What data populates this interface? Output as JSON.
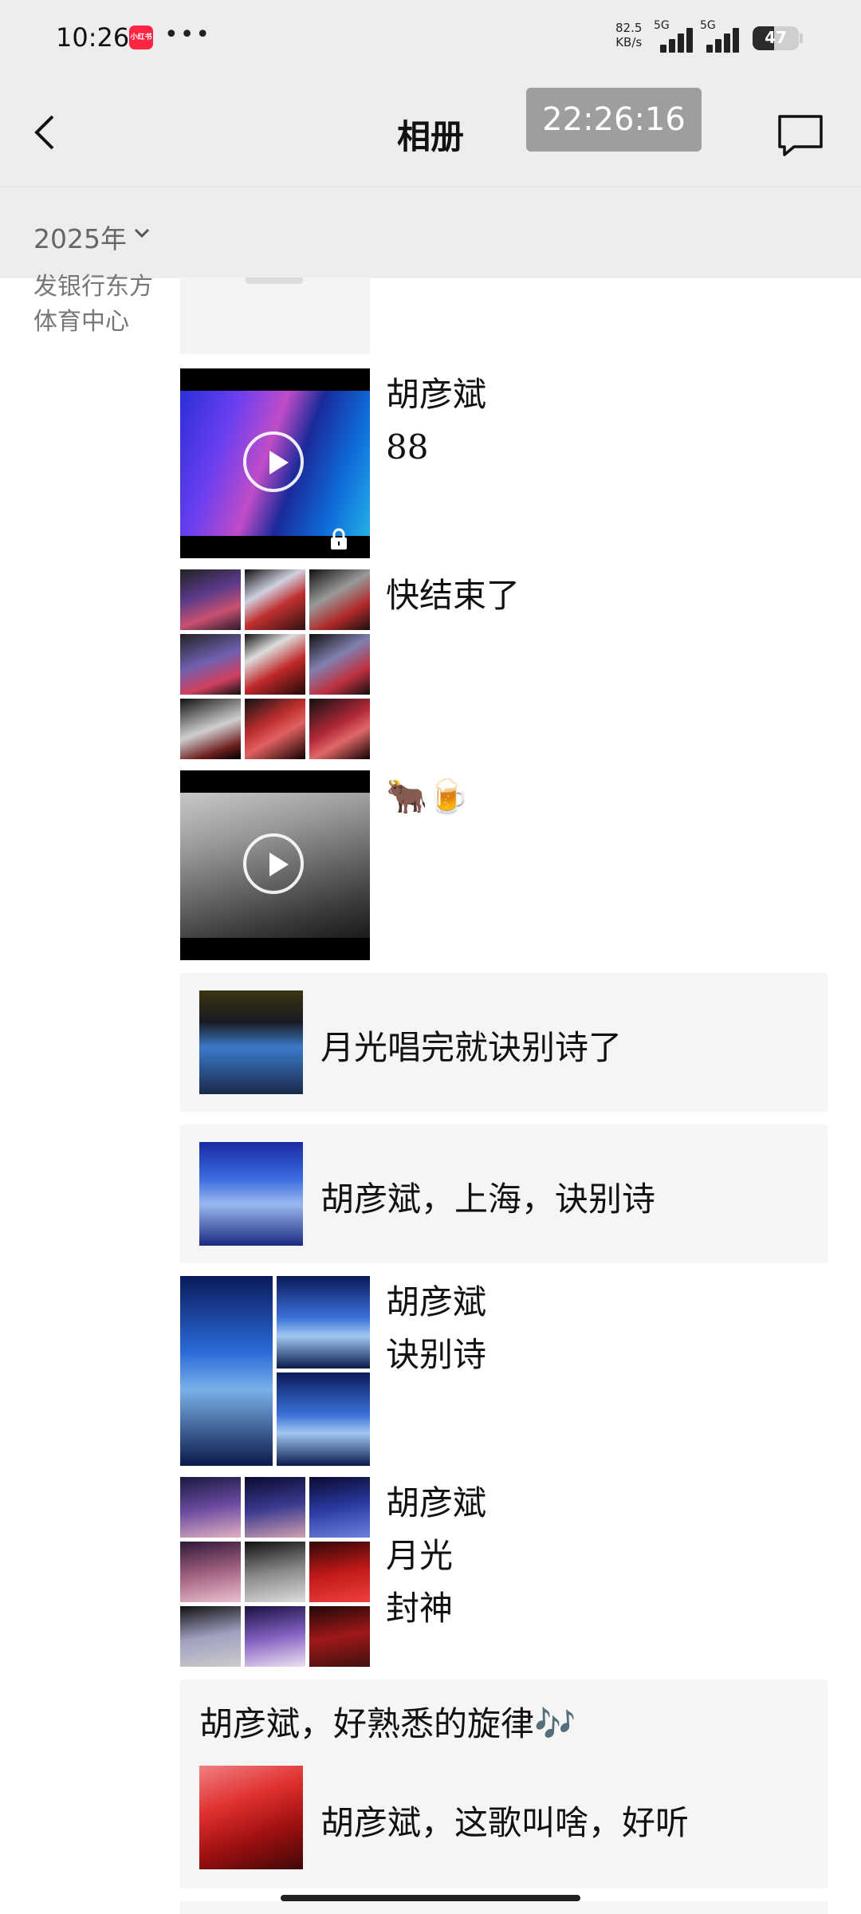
{
  "status_bar": {
    "time": "10:26",
    "app_badge": "小红书",
    "more": "•••",
    "speed_value": "82.5",
    "speed_unit": "KB/s",
    "net1": "5G",
    "net2": "5G",
    "battery": "47",
    "battery_level": 0.47
  },
  "nav": {
    "title": "相册",
    "time_badge": "22:26:16",
    "back_icon": "chevron-left-icon",
    "message_icon": "comment-icon"
  },
  "year_filter": {
    "label": "2025年",
    "icon": "chevron-down-icon"
  },
  "location": "发银行东方体育中心",
  "posts": [
    {
      "kind": "video",
      "locked": true,
      "captions": [
        "胡彦斌",
        "88"
      ]
    },
    {
      "kind": "images",
      "count": 9,
      "captions": [
        "快结束了"
      ]
    },
    {
      "kind": "video",
      "locked": false,
      "captions": [
        "🐂🍺"
      ]
    },
    {
      "kind": "share",
      "text": "月光唱完就诀别诗了"
    },
    {
      "kind": "share",
      "text": "胡彦斌，上海，诀别诗"
    },
    {
      "kind": "images",
      "count": 3,
      "captions": [
        "胡彦斌",
        "诀别诗"
      ]
    },
    {
      "kind": "images",
      "count": 9,
      "captions": [
        "胡彦斌",
        "月光",
        "封神"
      ]
    },
    {
      "kind": "share",
      "header": "胡彦斌，好熟悉的旋律🎶",
      "text": "胡彦斌，这歌叫啥，好听"
    }
  ],
  "colors": {
    "header_bg": "#ededed",
    "share_bg": "#f5f5f5",
    "time_badge_bg": "#9e9e9e",
    "app_badge": "#ff2442"
  }
}
